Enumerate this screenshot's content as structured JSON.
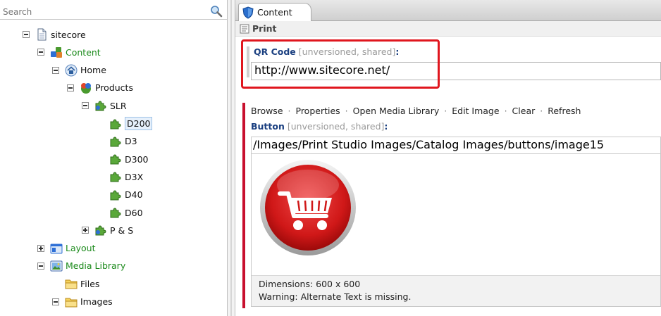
{
  "search": {
    "placeholder": "Search"
  },
  "tree": {
    "items": [
      {
        "label": "sitecore",
        "icon": "page-icon",
        "toggle": "minus",
        "color": "#111111"
      },
      {
        "label": "Content",
        "icon": "content-icon",
        "toggle": "minus",
        "color": "#1b8a1b"
      },
      {
        "label": "Home",
        "icon": "home-icon",
        "toggle": "minus",
        "color": "#111111"
      },
      {
        "label": "Products",
        "icon": "products-icon",
        "toggle": "minus",
        "color": "#111111"
      },
      {
        "label": "SLR",
        "icon": "puzzle-group-icon",
        "toggle": "minus",
        "color": "#111111"
      },
      {
        "label": "D200",
        "icon": "puzzle-icon",
        "toggle": "",
        "color": "#111111",
        "selected": true
      },
      {
        "label": "D3",
        "icon": "puzzle-icon",
        "toggle": "",
        "color": "#111111"
      },
      {
        "label": "D300",
        "icon": "puzzle-icon",
        "toggle": "",
        "color": "#111111"
      },
      {
        "label": "D3X",
        "icon": "puzzle-icon",
        "toggle": "",
        "color": "#111111"
      },
      {
        "label": "D40",
        "icon": "puzzle-icon",
        "toggle": "",
        "color": "#111111"
      },
      {
        "label": "D60",
        "icon": "puzzle-icon",
        "toggle": "",
        "color": "#111111"
      },
      {
        "label": "P & S",
        "icon": "puzzle-group-icon",
        "toggle": "plus",
        "color": "#111111"
      },
      {
        "label": "Layout",
        "icon": "layout-icon",
        "toggle": "plus",
        "color": "#1b8a1b"
      },
      {
        "label": "Media Library",
        "icon": "media-library-icon",
        "toggle": "minus",
        "color": "#1b8a1b"
      },
      {
        "label": "Files",
        "icon": "folder-icon",
        "toggle": "",
        "color": "#111111"
      },
      {
        "label": "Images",
        "icon": "folder-icon",
        "toggle": "minus",
        "color": "#111111"
      }
    ]
  },
  "tabs": {
    "content_label": "Content"
  },
  "section": {
    "title": "Print"
  },
  "qr_field": {
    "label": "QR Code",
    "meta": "[unversioned, shared]",
    "suffix": ":",
    "value": "http://www.sitecore.net/"
  },
  "button_field": {
    "actions": [
      "Browse",
      "Properties",
      "Open Media Library",
      "Edit Image",
      "Clear",
      "Refresh"
    ],
    "separator": "·",
    "label": "Button",
    "meta": "[unversioned, shared]",
    "suffix": ":",
    "path": "/Images/Print Studio Images/Catalog Images/buttons/image15",
    "dimensions": "Dimensions: 600 x 600",
    "warning": "Warning: Alternate Text is missing."
  },
  "colors": {
    "highlight": "#e0161e",
    "field_marker": "#c8102e",
    "field_title": "#1a3f80",
    "tree_green": "#1b8a1b"
  }
}
